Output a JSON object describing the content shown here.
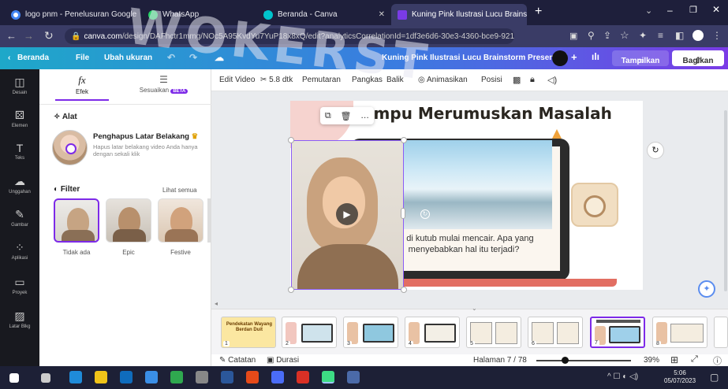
{
  "browser": {
    "tabs": [
      {
        "label": "logo pnm - Penelusuran Google"
      },
      {
        "label": "WhatsApp"
      },
      {
        "label": "Beranda - Canva"
      },
      {
        "label": "Kuning Pink Ilustrasi Lucu Brainst"
      }
    ],
    "url_domain": "canva.com",
    "url_path": "/design/DAFhctr1mmg/NOc5A95KvdYu7YuP18x8xQ/edit?analyticsCorrelationId=1df3e6d6-30e3-4360-bce9-921f44332eef"
  },
  "canva_header": {
    "home": "Beranda",
    "file": "File",
    "resize": "Ubah ukuran",
    "doc_title": "Kuning Pink Ilustrasi Lucu Brainstorm Presentasi",
    "present": "Tampilkan",
    "share": "Bagikan"
  },
  "rail": [
    {
      "label": "Desain",
      "icon": "layout-icon",
      "glyph": "◫"
    },
    {
      "label": "Elemen",
      "icon": "elements-icon",
      "glyph": "⚄"
    },
    {
      "label": "Teks",
      "icon": "text-icon",
      "glyph": "T"
    },
    {
      "label": "Unggahan",
      "icon": "upload-icon",
      "glyph": "☁"
    },
    {
      "label": "Gambar",
      "icon": "draw-icon",
      "glyph": "✎"
    },
    {
      "label": "Aplikasi",
      "icon": "apps-icon",
      "glyph": "⁘"
    },
    {
      "label": "Proyek",
      "icon": "folder-icon",
      "glyph": "▭"
    },
    {
      "label": "Latar Blkg",
      "icon": "background-icon",
      "glyph": "▨"
    }
  ],
  "panel": {
    "tab_effects": "Efek",
    "tab_adjust": "Sesuaikan",
    "beta": "BETA",
    "tools_heading": "Alat",
    "bg_remover_title": "Penghapus Latar Belakang",
    "bg_remover_desc1": "Hapus latar belakang video Anda hanya",
    "bg_remover_desc2": "dengan sekali klik",
    "filter_heading": "Filter",
    "see_all": "Lihat semua",
    "filters": [
      "Tidak ada",
      "Epic",
      "Festive"
    ]
  },
  "toolbar": {
    "edit_video": "Edit Video",
    "duration": "5.8 dtk",
    "crop": "Pemutaran",
    "flip": "Pangkas",
    "reverse": "Balik",
    "animate": "Animasikan",
    "position": "Posisi"
  },
  "slide": {
    "title": "Mampu Merumuskan Masalah",
    "caption_line1": "Es di kutub mulai mencair. Apa yang",
    "caption_line2": "menyebabkan hal itu terjadi?",
    "colors": {
      "title": "#2a2620",
      "laptop": "#2b2b2b",
      "accent": "#e9a5a3",
      "peach": "#f6d3cf"
    }
  },
  "film": {
    "thumbs": [
      "1",
      "2",
      "3",
      "4",
      "5",
      "6",
      "7",
      "8"
    ],
    "first_thumb_text": "Pendekatan Wayang Berdan Duit",
    "active_index": 7
  },
  "bottom": {
    "notes": "Catatan",
    "duration": "Durasi",
    "page": "Halaman 7 / 78",
    "zoom": "39%",
    "zoom_level": 0.3
  },
  "taskbar": {
    "time": "5:06",
    "date": "05/07/2023"
  },
  "watermark": "WOKERST"
}
